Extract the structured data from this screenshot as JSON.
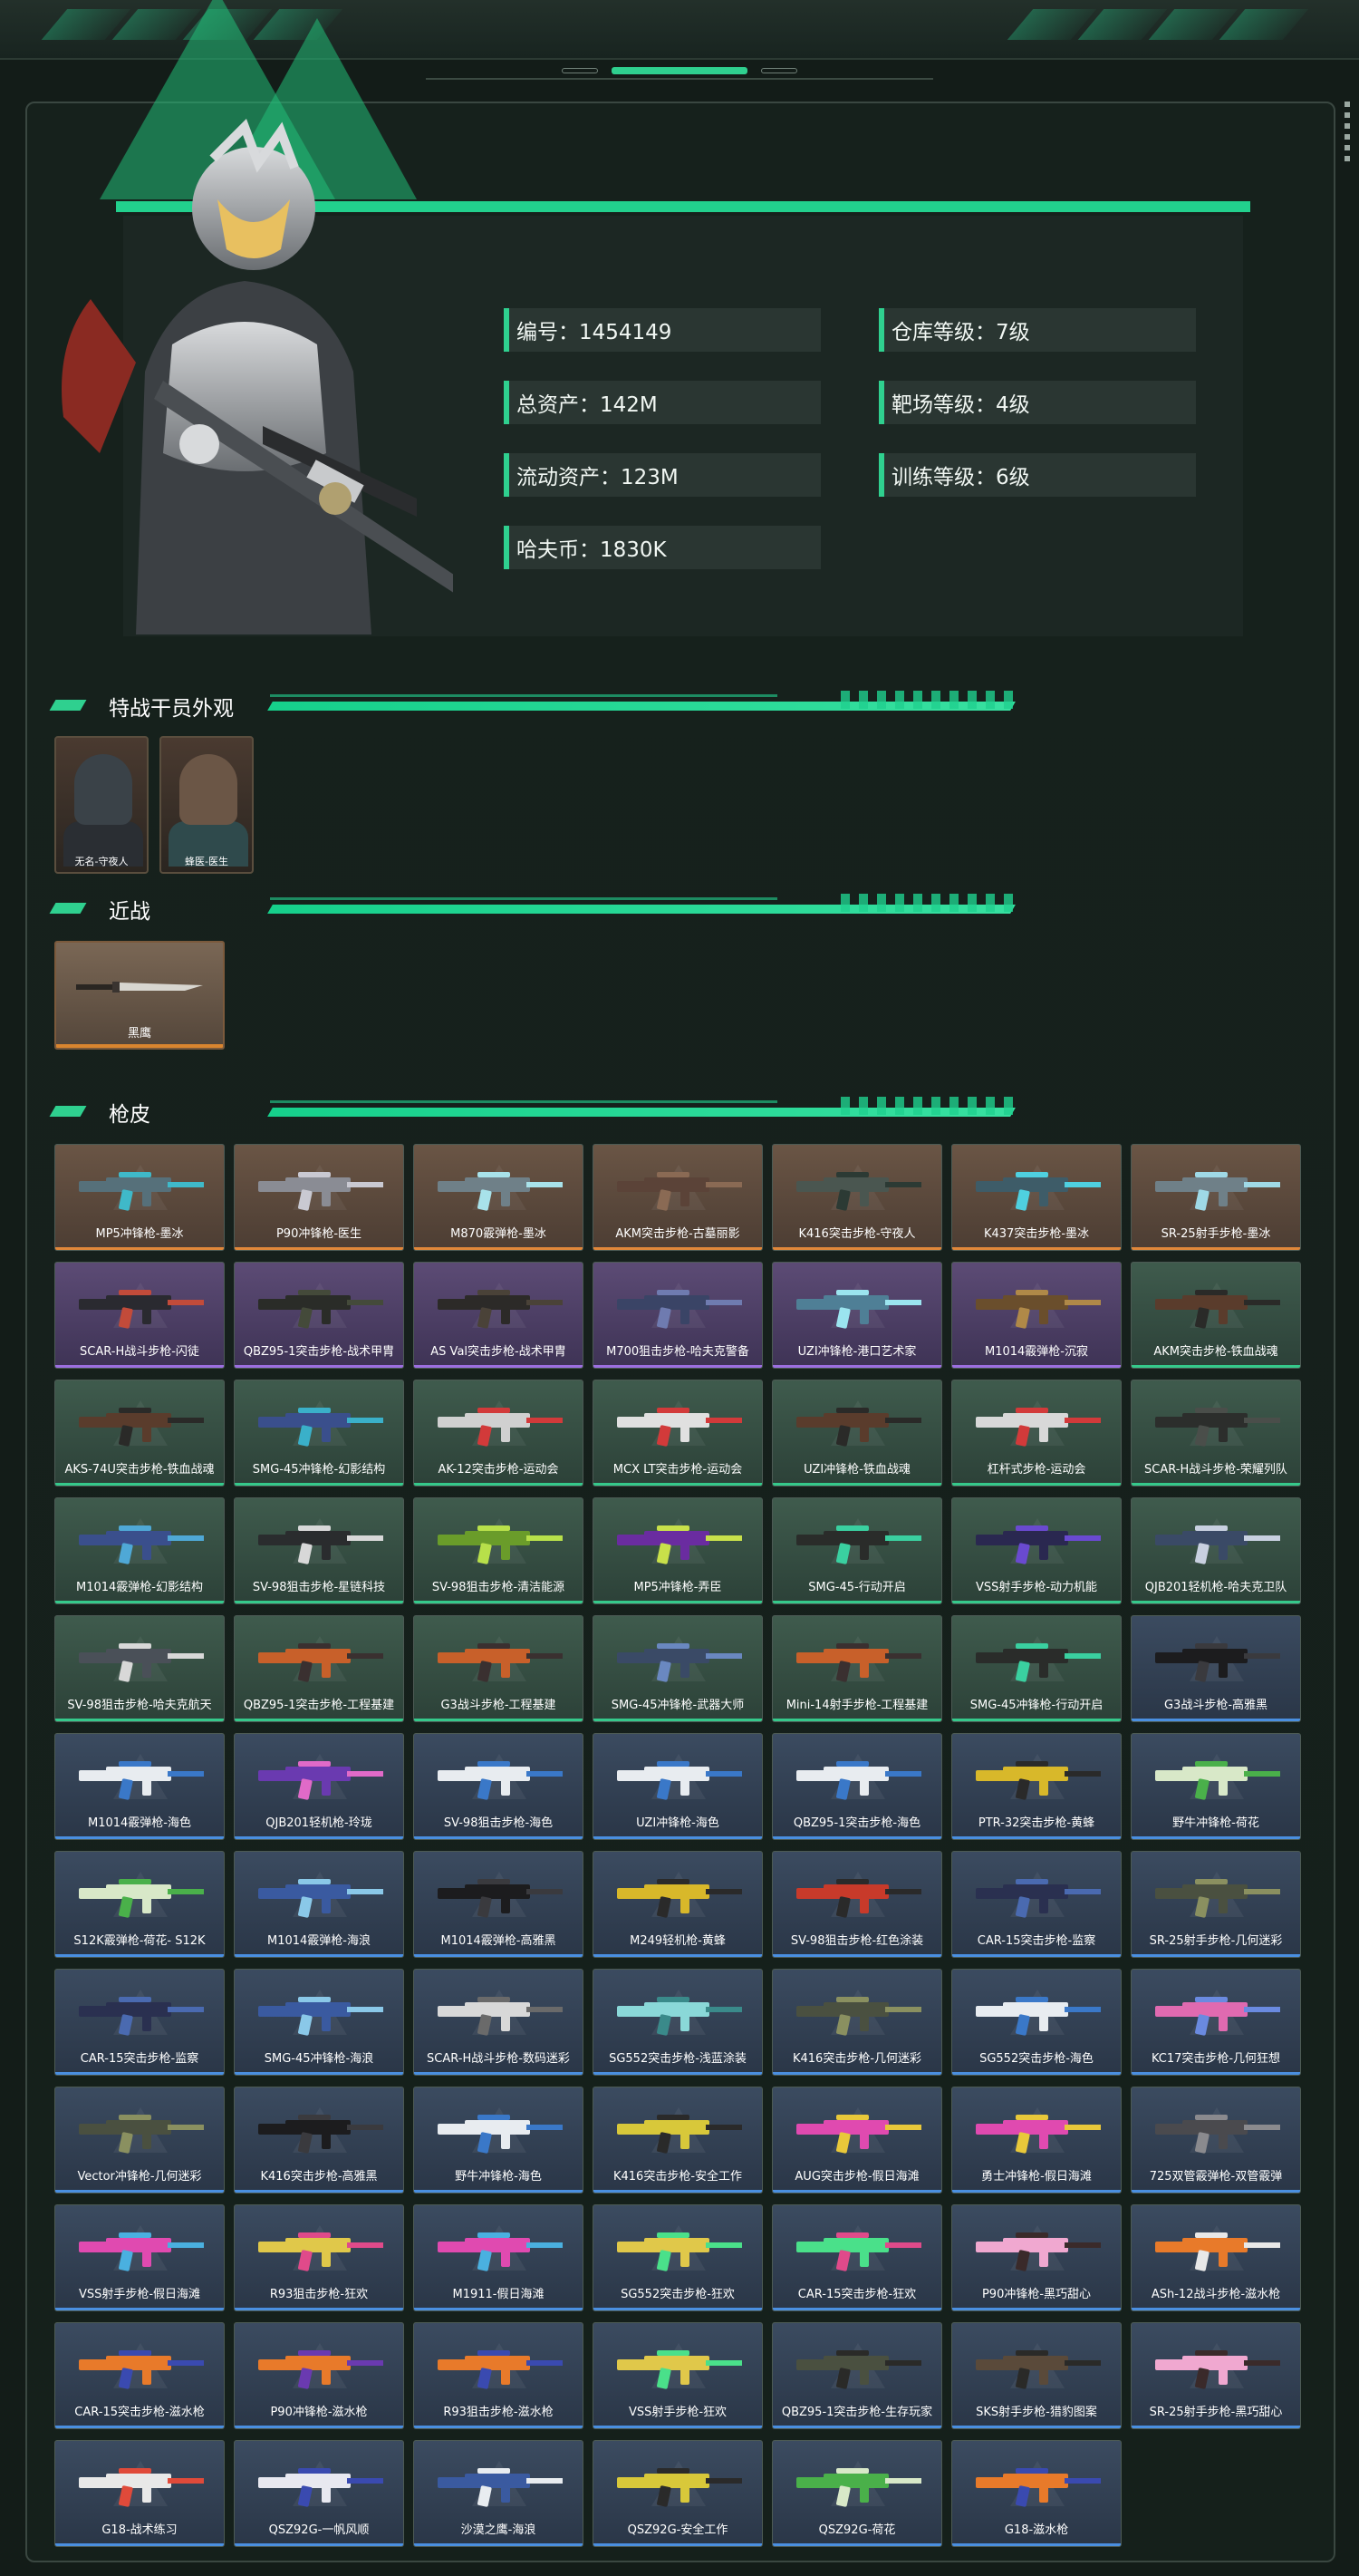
{
  "colors": {
    "accent": "#2fd08f",
    "background": "#131c18",
    "rarity_orange": "#e0873a",
    "rarity_purple": "#9c6fe0",
    "rarity_green": "#35c98b",
    "rarity_blue": "#4a8fe0"
  },
  "profile": {
    "id": "编号：1454149",
    "total_assets": "总资产：142M",
    "liquid_assets": "流动资产：123M",
    "havoc_coin": "哈夫币：1830K",
    "warehouse_level": "仓库等级：7级",
    "range_level": "靶场等级：4级",
    "training_level": "训练等级：6级"
  },
  "sections": {
    "operators": "特战干员外观",
    "melee": "近战",
    "skins": "枪皮"
  },
  "operators": [
    {
      "name": "无名-守夜人",
      "face": "#3a4248",
      "body": "#2a2e33"
    },
    {
      "name": "蜂医-医生",
      "face": "#6b5646",
      "body": "#2f4a4c"
    }
  ],
  "melee": {
    "name": "黑鹰"
  },
  "skins": [
    {
      "name": "MP5冲锋枪-墨冰",
      "rarity": "orange",
      "gun": "#56707a",
      "accent": "#3fb9c9"
    },
    {
      "name": "P90冲锋枪-医生",
      "rarity": "orange",
      "gun": "#8a8c94",
      "accent": "#c9c9d2"
    },
    {
      "name": "M870霰弹枪-墨冰",
      "rarity": "orange",
      "gun": "#6f8088",
      "accent": "#a8e2ea"
    },
    {
      "name": "AKM突击步枪-古墓丽影",
      "rarity": "orange",
      "gun": "#5b4338",
      "accent": "#8a6a54"
    },
    {
      "name": "K416突击步枪-守夜人",
      "rarity": "orange",
      "gun": "#4a5650",
      "accent": "#2c3a34"
    },
    {
      "name": "K437突击步枪-墨冰",
      "rarity": "orange",
      "gun": "#3e5c68",
      "accent": "#4fd0e0"
    },
    {
      "name": "SR-25射手步枪-墨冰",
      "rarity": "orange",
      "gun": "#6f8088",
      "accent": "#9fd9e6"
    },
    {
      "name": "SCAR-H战斗步枪-闪徒",
      "rarity": "purple",
      "gun": "#2a2a30",
      "accent": "#c24b3a"
    },
    {
      "name": "QBZ95-1突击步枪-战术甲胄",
      "rarity": "purple",
      "gun": "#2a2c28",
      "accent": "#444a3a"
    },
    {
      "name": "AS Val突击步枪-战术甲胄",
      "rarity": "purple",
      "gun": "#2c2a28",
      "accent": "#4a4238"
    },
    {
      "name": "M700狙击步枪-哈夫克警备",
      "rarity": "purple",
      "gun": "#3a4466",
      "accent": "#6f7bb0"
    },
    {
      "name": "UZI冲锋枪-港口艺术家",
      "rarity": "purple",
      "gun": "#4f7f96",
      "accent": "#9be4ef"
    },
    {
      "name": "M1014霰弹枪-沉寂",
      "rarity": "purple",
      "gun": "#6a4e2c",
      "accent": "#b08948"
    },
    {
      "name": "AKM突击步枪-铁血战魂",
      "rarity": "green",
      "gun": "#5a3c2c",
      "accent": "#2a2a28"
    },
    {
      "name": "AKS-74U突击步枪-铁血战魂",
      "rarity": "green",
      "gun": "#5a3c2c",
      "accent": "#2a2a28"
    },
    {
      "name": "SMG-45冲锋枪-幻影结构",
      "rarity": "green",
      "gun": "#3a4f8c",
      "accent": "#3ab0c9"
    },
    {
      "name": "AK-12突击步枪-运动会",
      "rarity": "green",
      "gun": "#d0d0d0",
      "accent": "#d23a3a"
    },
    {
      "name": "MCX LT突击步枪-运动会",
      "rarity": "green",
      "gun": "#e0e0e0",
      "accent": "#d23a3a"
    },
    {
      "name": "UZI冲锋枪-铁血战魂",
      "rarity": "green",
      "gun": "#5a3c2c",
      "accent": "#2a2a28"
    },
    {
      "name": "杠杆式步枪-运动会",
      "rarity": "green",
      "gun": "#d8d8d8",
      "accent": "#d23a3a"
    },
    {
      "name": "SCAR-H战斗步枪-荣耀列队",
      "rarity": "green",
      "gun": "#2c2e2c",
      "accent": "#4a4e4a"
    },
    {
      "name": "M1014霰弹枪-幻影结构",
      "rarity": "green",
      "gun": "#3a4f8c",
      "accent": "#4fa8d6"
    },
    {
      "name": "SV-98狙击步枪-星链科技",
      "rarity": "green",
      "gun": "#2a2c2e",
      "accent": "#d8d8d8"
    },
    {
      "name": "SV-98狙击步枪-清洁能源",
      "rarity": "green",
      "gun": "#6a9c2a",
      "accent": "#b8e04a"
    },
    {
      "name": "MP5冲锋枪-弄臣",
      "rarity": "green",
      "gun": "#6a2ca0",
      "accent": "#c8e04a"
    },
    {
      "name": "SMG-45-行动开启",
      "rarity": "green",
      "gun": "#2a2c2a",
      "accent": "#3ad0a0"
    },
    {
      "name": "VSS射手步枪-动力机能",
      "rarity": "green",
      "gun": "#2a2850",
      "accent": "#6a4ad0"
    },
    {
      "name": "QJB201轻机枪-哈夫克卫队",
      "rarity": "green",
      "gun": "#3a4a66",
      "accent": "#c8d0e0"
    },
    {
      "name": "SV-98狙击步枪-哈夫克航天",
      "rarity": "green",
      "gun": "#4a5058",
      "accent": "#d8d8d8"
    },
    {
      "name": "QBZ95-1突击步枪-工程基建",
      "rarity": "green",
      "gun": "#c8602a",
      "accent": "#3a3030"
    },
    {
      "name": "G3战斗步枪-工程基建",
      "rarity": "green",
      "gun": "#c8602a",
      "accent": "#3a3030"
    },
    {
      "name": "SMG-45冲锋枪-武器大师",
      "rarity": "green",
      "gun": "#3a4a66",
      "accent": "#6a88c0"
    },
    {
      "name": "Mini-14射手步枪-工程基建",
      "rarity": "green",
      "gun": "#c8602a",
      "accent": "#3a3030"
    },
    {
      "name": "SMG-45冲锋枪-行动开启",
      "rarity": "green",
      "gun": "#2a2c2a",
      "accent": "#3ad0a0"
    },
    {
      "name": "G3战斗步枪-高雅黑",
      "rarity": "blue",
      "gun": "#1c1c1e",
      "accent": "#3a3a3e"
    },
    {
      "name": "M1014霰弹枪-海色",
      "rarity": "blue",
      "gun": "#e8ecf0",
      "accent": "#3a78c8"
    },
    {
      "name": "QJB201轻机枪-玲珑",
      "rarity": "blue",
      "gun": "#6a3ab0",
      "accent": "#e06ac8"
    },
    {
      "name": "SV-98狙击步枪-海色",
      "rarity": "blue",
      "gun": "#e8ecf0",
      "accent": "#3a78c8"
    },
    {
      "name": "UZI冲锋枪-海色",
      "rarity": "blue",
      "gun": "#e8ecf0",
      "accent": "#3a78c8"
    },
    {
      "name": "QBZ95-1突击步枪-海色",
      "rarity": "blue",
      "gun": "#e8ecf0",
      "accent": "#3a78c8"
    },
    {
      "name": "PTR-32突击步枪-黄蜂",
      "rarity": "blue",
      "gun": "#d8b82a",
      "accent": "#2a2a2a"
    },
    {
      "name": "野牛冲锋枪-荷花",
      "rarity": "blue",
      "gun": "#d8e8c8",
      "accent": "#4ab04a"
    },
    {
      "name": "S12K霰弹枪-荷花- S12K",
      "rarity": "blue",
      "gun": "#d8e8c8",
      "accent": "#4ab04a"
    },
    {
      "name": "M1014霰弹枪-海浪",
      "rarity": "blue",
      "gun": "#3a5aa0",
      "accent": "#8ac8e8"
    },
    {
      "name": "M1014霰弹枪-高雅黑",
      "rarity": "blue",
      "gun": "#1c1c1e",
      "accent": "#3a3a3e"
    },
    {
      "name": "M249轻机枪-黄蜂",
      "rarity": "blue",
      "gun": "#d8b82a",
      "accent": "#2a2a2a"
    },
    {
      "name": "SV-98狙击步枪-红色涂装",
      "rarity": "blue",
      "gun": "#c83a2a",
      "accent": "#2a2a2a"
    },
    {
      "name": "CAR-15突击步枪-监察",
      "rarity": "blue",
      "gun": "#2a3050",
      "accent": "#4a6ab0"
    },
    {
      "name": "SR-25射手步枪-几何迷彩",
      "rarity": "blue",
      "gun": "#4a5040",
      "accent": "#8a9060"
    },
    {
      "name": "CAR-15突击步枪-监察",
      "rarity": "blue",
      "gun": "#2a3050",
      "accent": "#4a6ab0"
    },
    {
      "name": "SMG-45冲锋枪-海浪",
      "rarity": "blue",
      "gun": "#3a5aa0",
      "accent": "#8ac8e8"
    },
    {
      "name": "SCAR-H战斗步枪-数码迷彩",
      "rarity": "blue",
      "gun": "#d8d8d8",
      "accent": "#6a6a6a"
    },
    {
      "name": "SG552突击步枪-浅蓝涂装",
      "rarity": "blue",
      "gun": "#8ad8d8",
      "accent": "#3a8a8a"
    },
    {
      "name": "K416突击步枪-几何迷彩",
      "rarity": "blue",
      "gun": "#4a5040",
      "accent": "#8a9060"
    },
    {
      "name": "SG552突击步枪-海色",
      "rarity": "blue",
      "gun": "#e8ecf0",
      "accent": "#3a78c8"
    },
    {
      "name": "KC17突击步枪-几何狂想",
      "rarity": "blue",
      "gun": "#e06ab0",
      "accent": "#6a8ae0"
    },
    {
      "name": "Vector冲锋枪-几何迷彩",
      "rarity": "blue",
      "gun": "#4a5040",
      "accent": "#8a9060"
    },
    {
      "name": "K416突击步枪-高雅黑",
      "rarity": "blue",
      "gun": "#1c1c1e",
      "accent": "#3a3a3e"
    },
    {
      "name": "野牛冲锋枪-海色",
      "rarity": "blue",
      "gun": "#e8ecf0",
      "accent": "#3a78c8"
    },
    {
      "name": "K416突击步枪-安全工作",
      "rarity": "blue",
      "gun": "#d8c83a",
      "accent": "#2a2a2a"
    },
    {
      "name": "AUG突击步枪-假日海滩",
      "rarity": "blue",
      "gun": "#e04ab0",
      "accent": "#e8c83a"
    },
    {
      "name": "勇士冲锋枪-假日海滩",
      "rarity": "blue",
      "gun": "#e04ab0",
      "accent": "#e8c83a"
    },
    {
      "name": "725双管霰弹枪-双管霰弹",
      "rarity": "blue",
      "gun": "#4a4a4e",
      "accent": "#8a8a8e"
    },
    {
      "name": "VSS射手步枪-假日海滩",
      "rarity": "blue",
      "gun": "#e04ab0",
      "accent": "#4ab0e0"
    },
    {
      "name": "R93狙击步枪-狂欢",
      "rarity": "blue",
      "gun": "#e0c84a",
      "accent": "#e04a8a"
    },
    {
      "name": "M1911-假日海滩",
      "rarity": "blue",
      "gun": "#e04ab0",
      "accent": "#4ab0e0"
    },
    {
      "name": "SG552突击步枪-狂欢",
      "rarity": "blue",
      "gun": "#e0c84a",
      "accent": "#4ae08a"
    },
    {
      "name": "CAR-15突击步枪-狂欢",
      "rarity": "blue",
      "gun": "#4ae08a",
      "accent": "#e04a8a"
    },
    {
      "name": "P90冲锋枪-黑巧甜心",
      "rarity": "blue",
      "gun": "#f0a8d0",
      "accent": "#3a2a2a"
    },
    {
      "name": "ASh-12战斗步枪-滋水枪",
      "rarity": "blue",
      "gun": "#e87a2a",
      "accent": "#e8e8e8"
    },
    {
      "name": "CAR-15突击步枪-滋水枪",
      "rarity": "blue",
      "gun": "#e87a2a",
      "accent": "#3a4ab0"
    },
    {
      "name": "P90冲锋枪-滋水枪",
      "rarity": "blue",
      "gun": "#e87a2a",
      "accent": "#6a3ab0"
    },
    {
      "name": "R93狙击步枪-滋水枪",
      "rarity": "blue",
      "gun": "#e87a2a",
      "accent": "#3a4ab0"
    },
    {
      "name": "VSS射手步枪-狂欢",
      "rarity": "blue",
      "gun": "#e0c84a",
      "accent": "#4ae08a"
    },
    {
      "name": "QBZ95-1突击步枪-生存玩家",
      "rarity": "blue",
      "gun": "#4a5040",
      "accent": "#2a2a28"
    },
    {
      "name": "SKS射手步枪-猎豹图案",
      "rarity": "blue",
      "gun": "#5a4a3a",
      "accent": "#2a2a28"
    },
    {
      "name": "SR-25射手步枪-黑巧甜心",
      "rarity": "blue",
      "gun": "#f0a8d0",
      "accent": "#3a2a2a"
    },
    {
      "name": "G18-战术练习",
      "rarity": "blue",
      "gun": "#e8e8e8",
      "accent": "#e04a3a"
    },
    {
      "name": "QSZ92G-一帆风顺",
      "rarity": "blue",
      "gun": "#e8e8f0",
      "accent": "#3a4ab0"
    },
    {
      "name": "沙漠之鹰-海浪",
      "rarity": "blue",
      "gun": "#3a5aa0",
      "accent": "#e8ecf0"
    },
    {
      "name": "QSZ92G-安全工作",
      "rarity": "blue",
      "gun": "#d8c83a",
      "accent": "#2a2a2a"
    },
    {
      "name": "QSZ92G-荷花",
      "rarity": "blue",
      "gun": "#4ab04a",
      "accent": "#d8e8c8"
    },
    {
      "name": "G18-滋水枪",
      "rarity": "blue",
      "gun": "#e87a2a",
      "accent": "#3a4ab0"
    }
  ]
}
